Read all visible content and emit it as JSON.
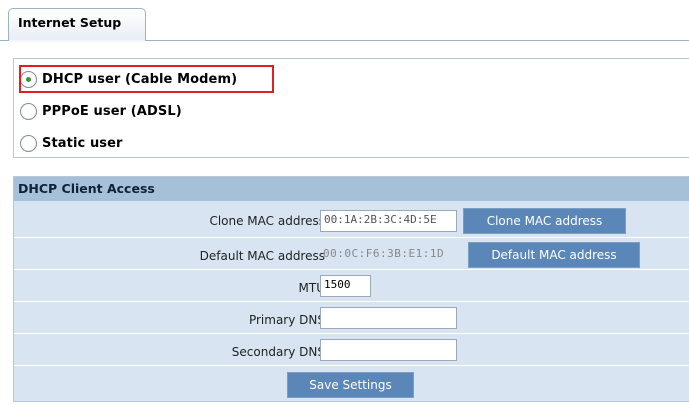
{
  "tab": {
    "label": "Internet Setup"
  },
  "connection_types": [
    {
      "label": "DHCP user (Cable Modem)",
      "checked": true
    },
    {
      "label": "PPPoE user (ADSL)",
      "checked": false
    },
    {
      "label": "Static user",
      "checked": false
    }
  ],
  "dhcp": {
    "header": "DHCP Client Access",
    "clone_mac": {
      "label": "Clone MAC address",
      "value": "00:1A:2B:3C:4D:5E",
      "button": "Clone MAC address"
    },
    "default_mac": {
      "label": "Default MAC address",
      "value": "00:0C:F6:3B:E1:1D",
      "button": "Default MAC address"
    },
    "mtu": {
      "label": "MTU",
      "value": "1500"
    },
    "primary_dns": {
      "label": "Primary DNS",
      "value": ""
    },
    "secondary_dns": {
      "label": "Secondary DNS",
      "value": ""
    },
    "save_button": "Save Settings"
  },
  "colors": {
    "highlight": "#e02020",
    "header_bg": "#a6c0da",
    "section_bg": "#d8e4f2",
    "button_bg": "#5b86b8"
  }
}
